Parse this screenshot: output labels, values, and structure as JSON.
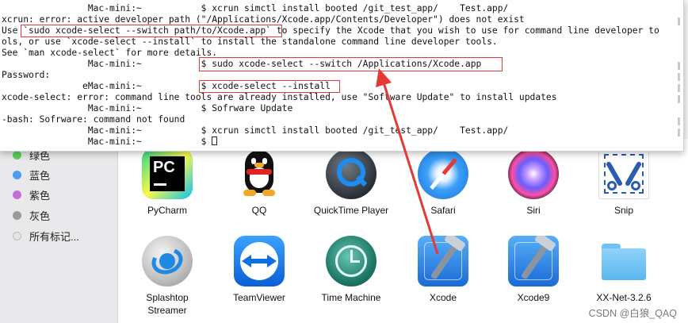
{
  "terminal": {
    "lines": [
      {
        "text": "                Mac-mini:~           $ xcrun simctl install booted /git_test_app/    Test.app/"
      },
      {
        "text": "xcrun: error: active developer path (\"/Applications/Xcode.app/Contents/Developer\") does not exist"
      },
      {
        "text": "Use `sudo xcode-select --switch path/to/Xcode.app` to specify the Xcode that you wish to use for command line developer to"
      },
      {
        "text": "ols, or use `xcode-select --install` to install the standalone command line developer tools."
      },
      {
        "text": "See `man xcode-select` for more details."
      },
      {
        "text": "                Mac-mini:~           $ sudo xcode-select --switch /Applications/Xcode.app"
      },
      {
        "text": "Password:"
      },
      {
        "text": "               eMac-mini:~           $ xcode-select --install"
      },
      {
        "text": "xcode-select: error: command line tools are already installed, use \"Software Update\" to install updates"
      },
      {
        "text": "                Mac-mini:~           $ Sofrware Update"
      },
      {
        "text": "-bash: Sofrware: command not found"
      },
      {
        "text": "                Mac-mini:~           $ xcrun simctl install booted /git_test_app/    Test.app/"
      },
      {
        "text": "                Mac-mini:~           $ "
      }
    ]
  },
  "sidebar": {
    "tags": [
      {
        "label": "绿色",
        "color": "#5ccf5a"
      },
      {
        "label": "蓝色",
        "color": "#4a9df0"
      },
      {
        "label": "紫色",
        "color": "#c56fd9"
      },
      {
        "label": "灰色",
        "color": "#9a9a9a"
      },
      {
        "label": "所有标记...",
        "color": "#e4e4e4"
      }
    ]
  },
  "apps": [
    {
      "label": "PyCharm",
      "icon": "pycharm-icon"
    },
    {
      "label": "QQ",
      "icon": "qq-penguin-icon"
    },
    {
      "label": "QuickTime Player",
      "icon": "quicktime-icon"
    },
    {
      "label": "Safari",
      "icon": "safari-compass-icon"
    },
    {
      "label": "Siri",
      "icon": "siri-icon"
    },
    {
      "label": "Snip",
      "icon": "scissors-icon"
    },
    {
      "label": "Splashtop\nStreamer",
      "label1": "Splashtop",
      "label2": "Streamer",
      "icon": "splashtop-icon"
    },
    {
      "label": "TeamViewer",
      "icon": "teamviewer-icon"
    },
    {
      "label": "Time Machine",
      "icon": "time-machine-icon"
    },
    {
      "label": "Xcode",
      "icon": "xcode-hammer-icon"
    },
    {
      "label": "Xcode9",
      "icon": "xcode-hammer-icon"
    },
    {
      "label": "XX-Net-3.2.6",
      "icon": "folder-icon"
    }
  ],
  "watermark": "CSDN @白狼_QAQ",
  "colors": {
    "highlight": "#e53935",
    "arrow": "#e53935"
  }
}
